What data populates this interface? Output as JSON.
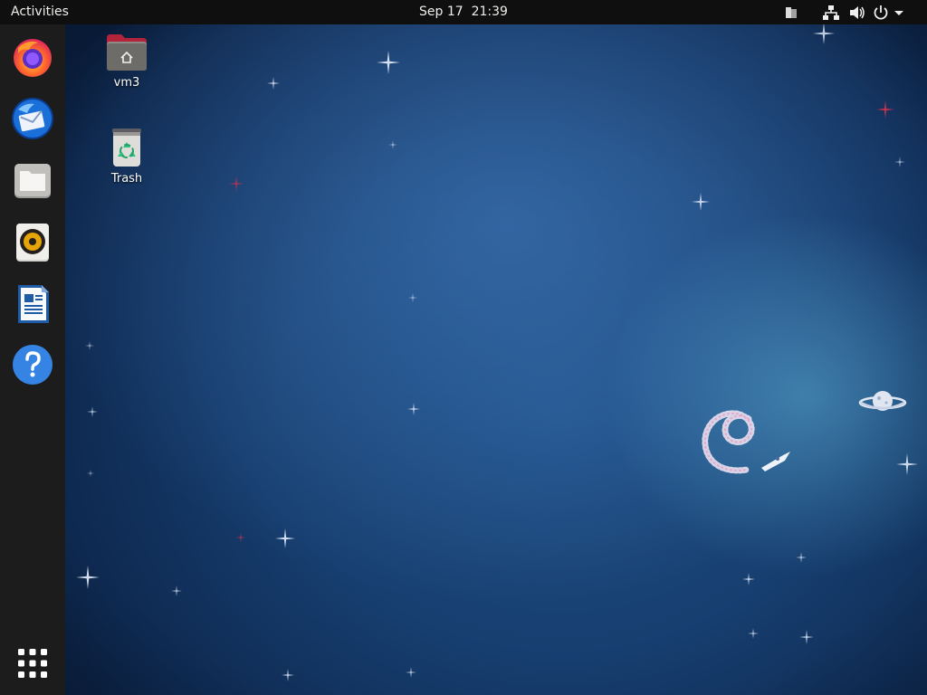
{
  "topbar": {
    "activities_label": "Activities",
    "clock": "Sep 17  21:39",
    "tray_icons": [
      "clipboard-icon",
      "network-icon",
      "volume-icon",
      "power-icon",
      "menu-arrow-icon"
    ]
  },
  "dock": {
    "items": [
      {
        "name": "Firefox",
        "icon": "firefox-icon"
      },
      {
        "name": "Thunderbird",
        "icon": "thunderbird-icon"
      },
      {
        "name": "Files",
        "icon": "files-icon"
      },
      {
        "name": "Rhythmbox",
        "icon": "rhythmbox-icon"
      },
      {
        "name": "LibreOffice Writer",
        "icon": "writer-icon"
      },
      {
        "name": "Help",
        "icon": "help-icon"
      }
    ],
    "show_apps_icon": "app-grid-icon"
  },
  "desktop": {
    "icons": [
      {
        "label": "vm3",
        "icon": "home-folder-icon"
      },
      {
        "label": "Trash",
        "icon": "trash-icon"
      }
    ]
  },
  "colors": {
    "topbar": "#0f0f0f",
    "dock": "#1c1c1c",
    "wallpaper_base": "#1f4f86"
  }
}
